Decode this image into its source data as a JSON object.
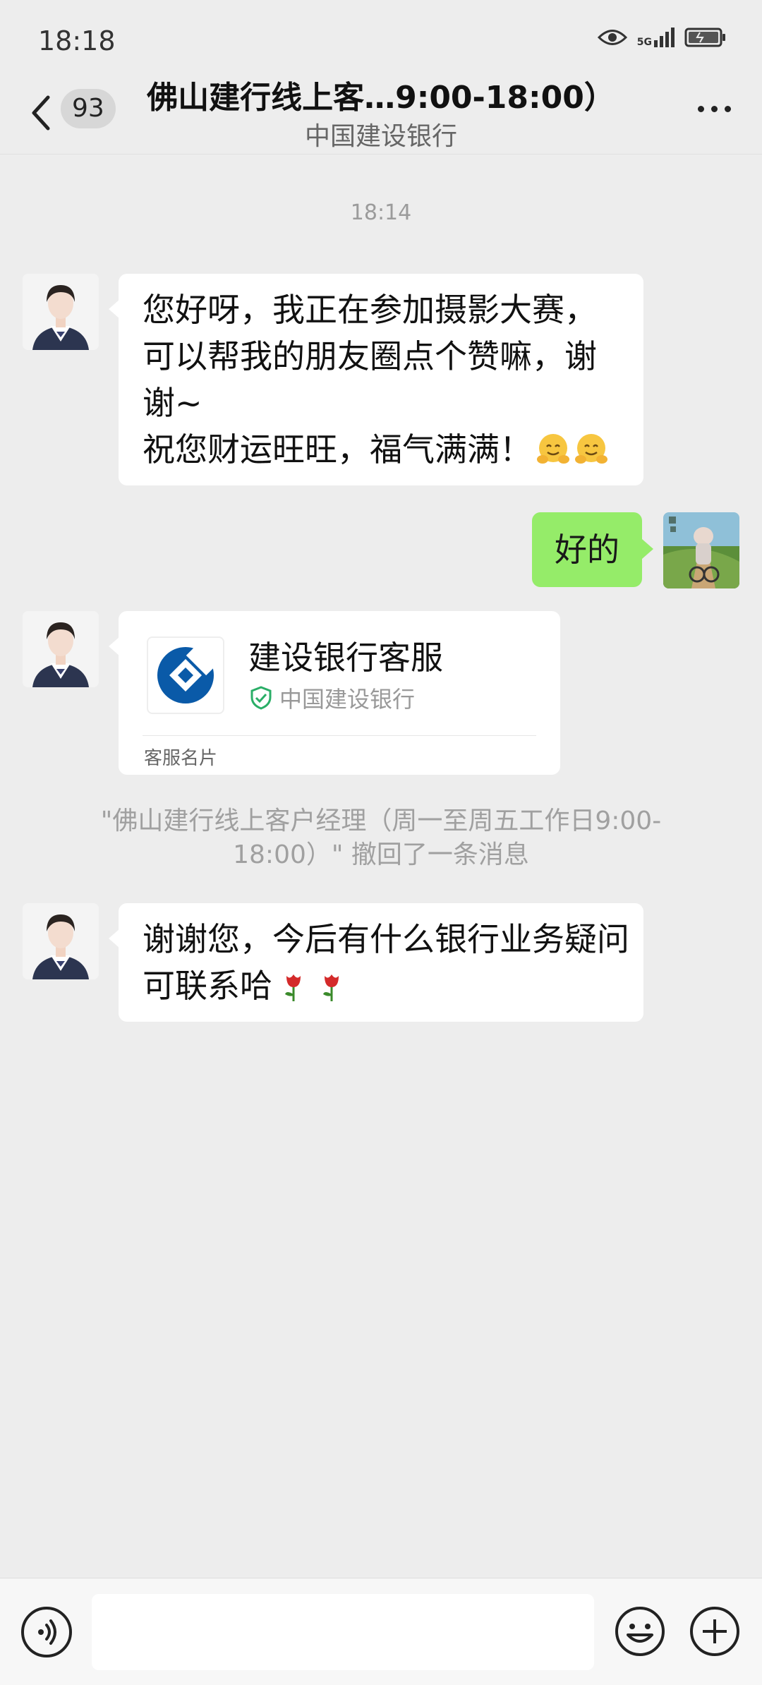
{
  "status_bar": {
    "time": "18:18",
    "network": "5G"
  },
  "header": {
    "unread_count": "93",
    "title": "佛山建行线上客…9:00-18:00）",
    "subtitle": "中国建设银行"
  },
  "messages": {
    "timestamp": "18:14",
    "m1": {
      "lines": [
        "您好呀，我正在参加摄影大赛，",
        "可以帮我的朋友圈点个赞嘛，谢",
        "谢~",
        "祝您财运旺旺，福气满满！"
      ]
    },
    "m2_sent": {
      "text": "好的"
    },
    "card": {
      "name": "建设银行客服",
      "org": "中国建设银行",
      "type": "客服名片"
    },
    "recall_notice": "\"佛山建行线上客户经理（周一至周五工作日9:00-18:00）\" 撤回了一条消息",
    "m3": {
      "lines": [
        "谢谢您，今后有什么银行业务疑问",
        "可联系哈"
      ]
    }
  },
  "input_bar": {
    "placeholder": ""
  },
  "colors": {
    "background": "#ededed",
    "sent_bubble": "#95ec69",
    "received_bubble": "#ffffff",
    "verify_green": "#2aae67",
    "ccb_blue": "#0a5aa8"
  },
  "icons": [
    "back-arrow-icon",
    "more-icon",
    "eye-icon",
    "signal-icon",
    "battery-icon",
    "verified-shield-icon",
    "voice-icon",
    "emoji-icon",
    "plus-icon",
    "hug-emoji-icon",
    "rose-emoji-icon"
  ]
}
